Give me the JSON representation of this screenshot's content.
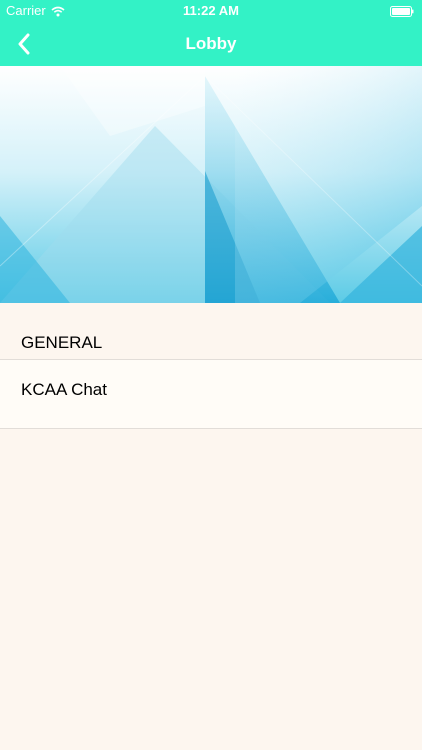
{
  "status_bar": {
    "carrier": "Carrier",
    "time": "11:22 AM",
    "wifi_icon": "wifi-icon",
    "battery_icon": "battery-icon"
  },
  "nav": {
    "title": "Lobby",
    "back_icon": "chevron-left-icon",
    "background_color": "#33f2c6"
  },
  "banner": {
    "description": "abstract light-blue geometric banner"
  },
  "sections": [
    {
      "header": "GENERAL",
      "items": [
        {
          "label": "KCAA Chat"
        }
      ]
    }
  ],
  "colors": {
    "page_background": "#fdf6ef",
    "accent": "#33f2c6",
    "banner_blue": "#29b6e0"
  }
}
